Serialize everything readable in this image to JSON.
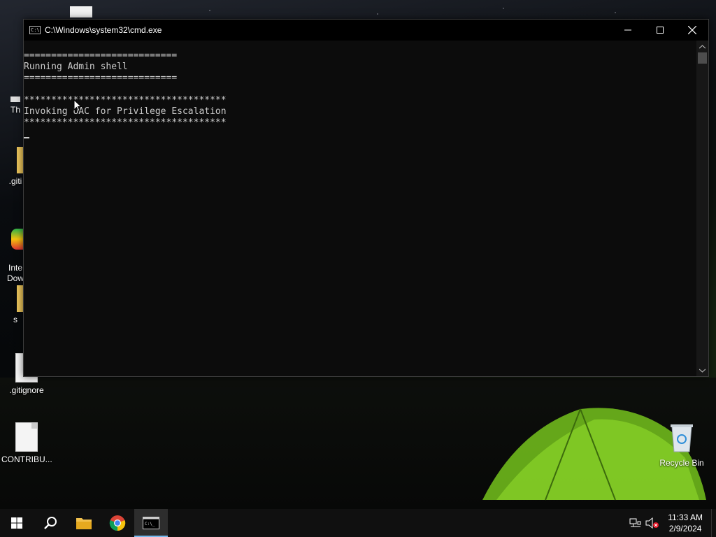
{
  "desktop": {
    "icons": [
      {
        "label": "Th"
      },
      {
        "label": ".giti"
      },
      {
        "label": "Inte\nDow"
      },
      {
        "label": "s"
      },
      {
        "label": ".gitignore"
      },
      {
        "label": "CONTRIBU..."
      },
      {
        "label": "Recycle Bin"
      }
    ]
  },
  "window": {
    "title": "C:\\Windows\\system32\\cmd.exe",
    "icon": "cmd-icon",
    "controls": [
      "minimize-icon",
      "maximize-icon",
      "close-icon"
    ],
    "console_lines": [
      "",
      "============================",
      "Running Admin shell",
      "============================",
      "",
      "*************************************",
      "Invoking UAC for Privilege Escalation",
      "*************************************",
      ""
    ]
  },
  "taskbar": {
    "items": [
      "start-icon",
      "search-icon",
      "file-explorer-icon",
      "chrome-icon",
      "cmd-taskbar-icon"
    ],
    "tray": {
      "time": "11:33 AM",
      "date": "2/9/2024",
      "icons": [
        "network-icon",
        "volume-muted-icon"
      ]
    }
  }
}
